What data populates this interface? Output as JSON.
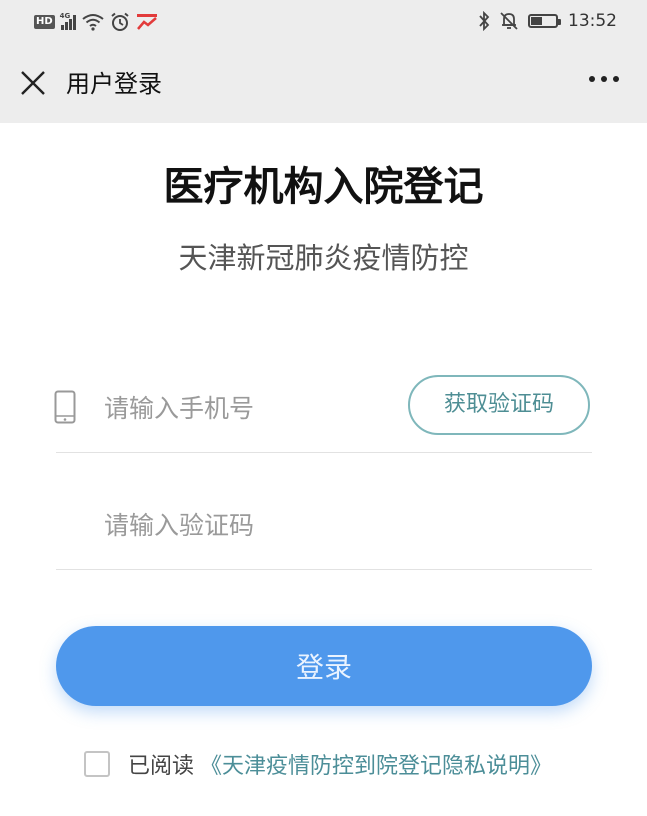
{
  "status_bar": {
    "hd": "HD",
    "network": "4G",
    "time": "13:52",
    "battery_level": 0.5
  },
  "titlebar": {
    "title": "用户登录",
    "close_icon": "close-icon",
    "more_icon": "more-icon"
  },
  "main": {
    "heading": "医疗机构入院登记",
    "subheading": "天津新冠肺炎疫情防控",
    "phone_placeholder": "请输入手机号",
    "get_code_label": "获取验证码",
    "code_placeholder": "请输入验证码",
    "login_label": "登录",
    "agree_prefix": "已阅读",
    "policy_link": "《天津疫情防控到院登记隐私说明》"
  },
  "colors": {
    "accent": "#4f98ec",
    "link": "#4c8e98",
    "outline": "#7fb7bb",
    "header_bg": "#ededed"
  }
}
